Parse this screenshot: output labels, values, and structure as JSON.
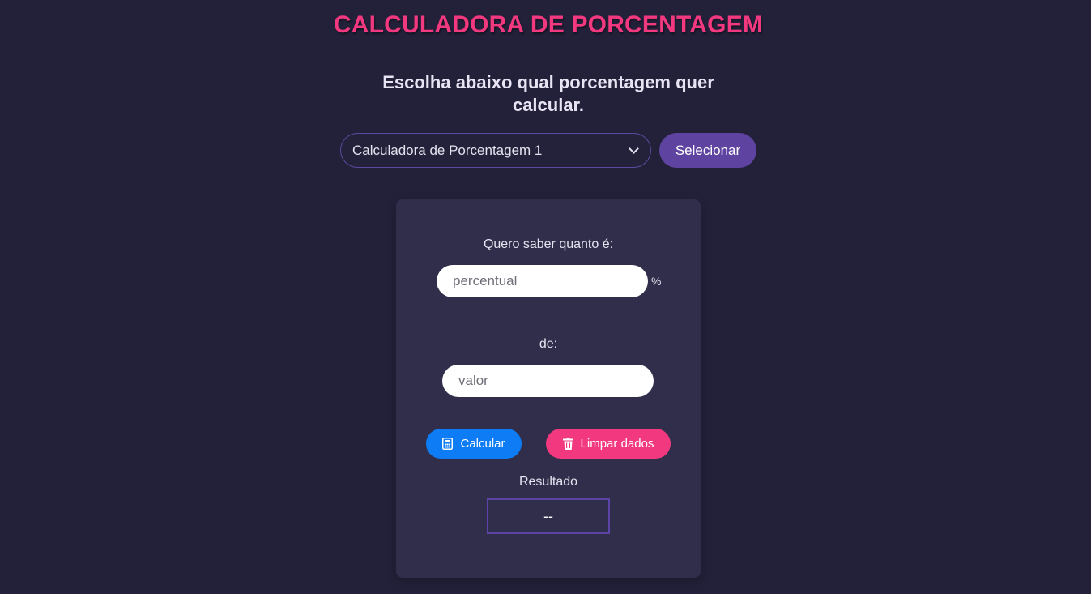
{
  "header": {
    "title": "CALCULADORA DE PORCENTAGEM",
    "subtitle_line1": "Escolha abaixo qual porcentagem quer",
    "subtitle_line2": "calcular."
  },
  "selector": {
    "selected_option": "Calculadora de Porcentagem 1",
    "button_label": "Selecionar"
  },
  "calculator": {
    "prompt_label": "Quero saber quanto é:",
    "percent_placeholder": "percentual",
    "percent_sign": "%",
    "of_label": "de:",
    "value_placeholder": "valor",
    "calculate_label": "Calcular",
    "calculate_icon": "calculator-icon",
    "clear_label": "Limpar dados",
    "clear_icon": "trash-icon",
    "result_label": "Resultado",
    "result_value": "--"
  },
  "colors": {
    "background": "#23213a",
    "card": "#302e4b",
    "title": "#f2387e",
    "accent_purple": "#5e43a1",
    "calculate_blue": "#0d7cf5",
    "clear_pink": "#f2387e"
  }
}
